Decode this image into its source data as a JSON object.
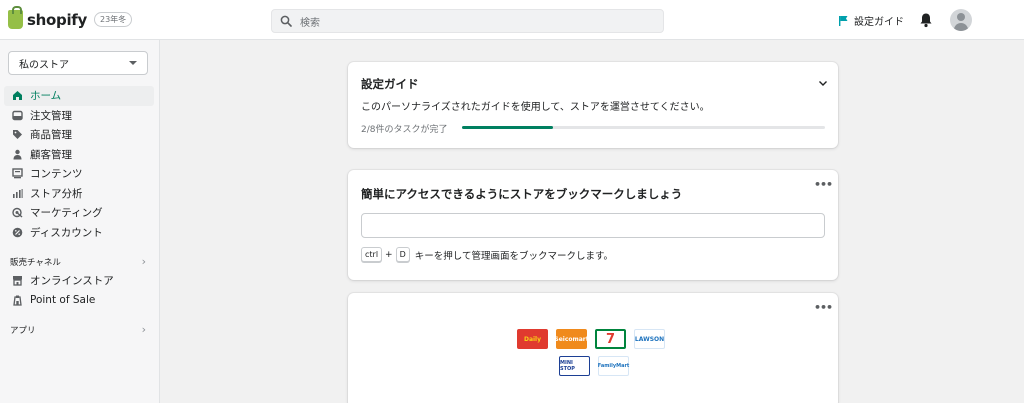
{
  "topbar": {
    "brand": "shopify",
    "plan_badge": "23年冬",
    "search_placeholder": "検索",
    "guide_label": "設定ガイド"
  },
  "sidebar": {
    "store_name": "私のストア",
    "nav_items": [
      {
        "label": "ホーム",
        "icon": "home-icon"
      },
      {
        "label": "注文管理",
        "icon": "inbox-icon"
      },
      {
        "label": "商品管理",
        "icon": "tag-icon"
      },
      {
        "label": "顧客管理",
        "icon": "person-icon"
      },
      {
        "label": "コンテンツ",
        "icon": "image-icon"
      },
      {
        "label": "ストア分析",
        "icon": "bar-chart-icon"
      },
      {
        "label": "マーケティング",
        "icon": "target-icon"
      },
      {
        "label": "ディスカウント",
        "icon": "discount-icon"
      }
    ],
    "sales_channels_label": "販売チャネル",
    "channels": [
      {
        "label": "オンラインストア",
        "icon": "store-icon"
      },
      {
        "label": "Point of Sale",
        "icon": "pos-icon"
      }
    ],
    "apps_label": "アプリ"
  },
  "setup_card": {
    "title": "設定ガイド",
    "description": "このパーソナライズされたガイドを使用して、ストアを運営させてください。",
    "progress_label": "2/8件のタスクが完了",
    "progress_fraction": 0.25
  },
  "bookmark_card": {
    "title": "簡単にアクセスできるようにストアをブックマークしましょう",
    "key_ctrl": "ctrl",
    "key_plus": "+",
    "key_d": "D",
    "hint_text": "キーを押して管理画面をブックマークします。",
    "menu": "•••"
  },
  "stores_card": {
    "menu": "•••",
    "logos": [
      {
        "name": "Daily",
        "text": "Daily",
        "bg": "#e03a2f",
        "fg": "#f7d117"
      },
      {
        "name": "Seicomart",
        "text": "Seicomart",
        "bg": "#f08a1c",
        "fg": "#ffffff"
      },
      {
        "name": "7-Eleven",
        "text": "7",
        "bg": "#ffffff",
        "fg": "#e03a2f"
      },
      {
        "name": "LAWSON",
        "text": "LAWSON",
        "bg": "#ffffff",
        "fg": "#1e73be"
      },
      {
        "name": "MINISTOP",
        "text": "MINI STOP",
        "bg": "#ffffff",
        "fg": "#1c3f94"
      },
      {
        "name": "FamilyMart",
        "text": "FamilyMart",
        "bg": "#ffffff",
        "fg": "#1e73be"
      }
    ]
  },
  "colors": {
    "accent": "#008060",
    "active_nav_text": "#007f5f",
    "guide_flag": "#00a0ac"
  }
}
